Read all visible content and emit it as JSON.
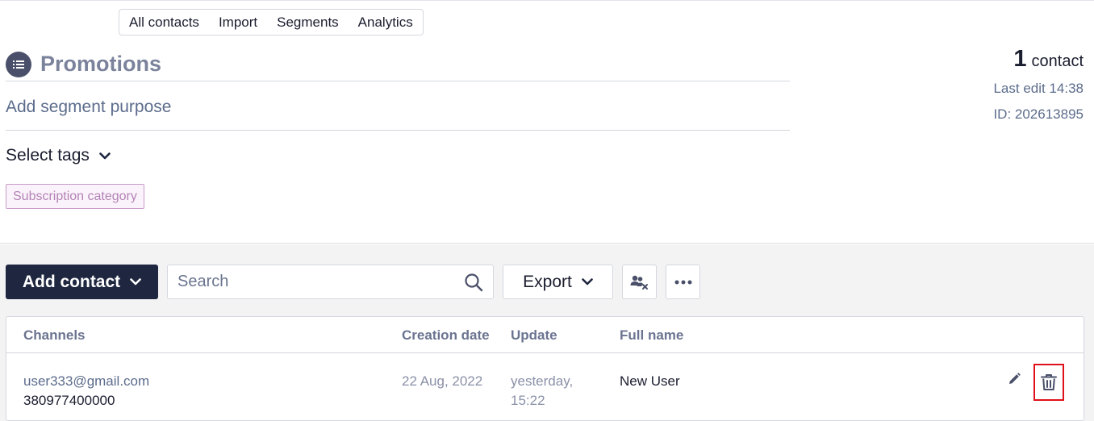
{
  "nav": {
    "tabs": [
      "All contacts",
      "Import",
      "Segments",
      "Analytics"
    ]
  },
  "segment": {
    "icon": "list-icon",
    "title": "Promotions",
    "purpose_placeholder": "Add segment purpose",
    "select_tags_label": "Select tags",
    "tag": "Subscription category"
  },
  "stats": {
    "count": "1",
    "count_label": "contact",
    "last_edit": "Last edit 14:38",
    "id": "ID: 202613895"
  },
  "toolbar": {
    "add_contact_label": "Add contact",
    "search_placeholder": "Search",
    "export_label": "Export",
    "remove_users_icon": "remove-users-icon",
    "more_icon": "more-horizontal-icon"
  },
  "table": {
    "columns": [
      "Channels",
      "Creation date",
      "Update",
      "Full name"
    ],
    "rows": [
      {
        "email": "user333@gmail.com",
        "phone": "380977400000",
        "creation_date": "22 Aug, 2022",
        "update_line1": "yesterday,",
        "update_line2": "15:22",
        "full_name": "New User"
      }
    ]
  },
  "colors": {
    "primary_button": "#1e2640",
    "title": "#7b829c",
    "link": "#5c6c8c",
    "tag_border": "#c99bc9",
    "tag_text": "#b383b5",
    "highlight": "#e0101a"
  }
}
